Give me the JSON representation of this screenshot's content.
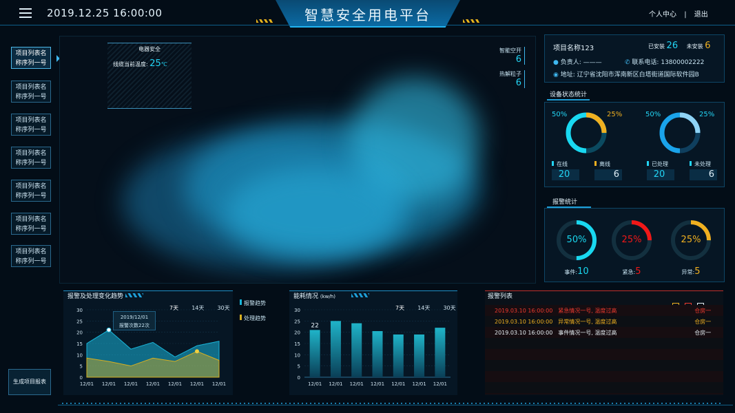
{
  "header": {
    "datetime": "2019.12.25  16:00:00",
    "title": "智慧安全用电平台",
    "profile": "个人中心",
    "divider": "|",
    "logout": "退出"
  },
  "sidebar": {
    "items": [
      {
        "line1": "项目列表名",
        "line2": "称序列一号"
      },
      {
        "line1": "项目列表名",
        "line2": "称序列一号"
      },
      {
        "line1": "项目列表名",
        "line2": "称序列一号"
      },
      {
        "line1": "项目列表名",
        "line2": "称序列一号"
      },
      {
        "line1": "项目列表名",
        "line2": "称序列一号"
      },
      {
        "line1": "项目列表名",
        "line2": "称序列一号"
      },
      {
        "line1": "项目列表名",
        "line2": "称序列一号"
      }
    ],
    "report_button": "生成项目报表"
  },
  "electric_box": {
    "title": "电器安全",
    "label": "线缆当前温度:",
    "value": "25",
    "unit": "℃"
  },
  "map_stats": [
    {
      "label": "智能空开",
      "value": "6"
    },
    {
      "label": "热解粒子",
      "value": "6"
    }
  ],
  "project": {
    "name": "项目名称123",
    "installed_label": "已安装",
    "installed": "26",
    "uninstalled_label": "未安装",
    "uninstalled": "6",
    "owner_label": "负责人:",
    "owner": "———",
    "phone_label": "联系电话:",
    "phone": "13800002222",
    "address_label": "地址:",
    "address": "辽宁省沈阳市浑南新区白塔街道国际软件园B"
  },
  "device_status": {
    "title": "设备状态统计",
    "ring1": {
      "left_pct": "50%",
      "right_pct": "25%",
      "fraction": 0.75
    },
    "ring2": {
      "left_pct": "50%",
      "right_pct": "25%",
      "fraction": 0.75
    },
    "stats": [
      {
        "label": "在线",
        "value": "20"
      },
      {
        "label": "离线",
        "value": "6"
      },
      {
        "label": "已处理",
        "value": "20"
      },
      {
        "label": "未处理",
        "value": "6"
      }
    ]
  },
  "alarm_stats": {
    "title": "报警统计",
    "rings": [
      {
        "pct": "50%",
        "fraction": 0.5,
        "label": "事件:",
        "value": "10",
        "color": "#19d8f0"
      },
      {
        "pct": "25%",
        "fraction": 0.25,
        "label": "紧急:",
        "value": "5",
        "color": "#f01818"
      },
      {
        "pct": "25%",
        "fraction": 0.25,
        "label": "异常:",
        "value": "5",
        "color": "#f0b020"
      }
    ]
  },
  "trend_chart": {
    "title": "报警及处理变化趋势",
    "tabs": [
      "7天",
      "14天",
      "30天"
    ],
    "legend": [
      "报警趋势",
      "处理趋势"
    ],
    "tooltip_date": "2019/12/01",
    "tooltip_text": "报警次数22次"
  },
  "energy_chart": {
    "title": "能耗情况",
    "unit": "(kw/h)",
    "tabs": [
      "7天",
      "14天",
      "30天"
    ],
    "top_label": "22"
  },
  "alarm_list": {
    "title": "报警列表",
    "rows": [
      {
        "time": "2019.03.10  16:00:00",
        "event": "紧急情况一号, 温度过高",
        "place": "仓房一",
        "color": "#ef3a2e"
      },
      {
        "time": "2019.03.10  16:00:00",
        "event": "异常情况一号, 温度过高",
        "place": "仓房一",
        "color": "#f0b020"
      },
      {
        "time": "2019.03.10  16:00:00",
        "event": "事件情况一号, 温度过高",
        "place": "仓房一",
        "color": "#e6eef3"
      }
    ]
  },
  "chart_data": [
    {
      "type": "area",
      "title": "报警及处理变化趋势",
      "x": [
        "12/01",
        "12/01",
        "12/01",
        "12/01",
        "12/01",
        "12/01",
        "12/01"
      ],
      "ylim": [
        0,
        30
      ],
      "yticks": [
        "0",
        "5",
        "10",
        "15",
        "20",
        "25",
        "30"
      ],
      "series": [
        {
          "name": "报警趋势",
          "values": [
            15,
            21,
            12.5,
            15.5,
            9,
            14,
            16
          ]
        },
        {
          "name": "处理趋势",
          "values": [
            8.5,
            7,
            5,
            8.5,
            7,
            11.5,
            7.5
          ]
        }
      ]
    },
    {
      "type": "bar",
      "title": "能耗情况",
      "categories": [
        "12/01",
        "12/01",
        "12/01",
        "12/01",
        "12/01",
        "12/01",
        "12/01"
      ],
      "values": [
        21,
        25,
        24,
        20.5,
        19,
        19,
        22
      ],
      "ylim": [
        0,
        30
      ],
      "yticks": [
        "0",
        "5",
        "10",
        "15",
        "20",
        "25",
        "30"
      ]
    }
  ]
}
